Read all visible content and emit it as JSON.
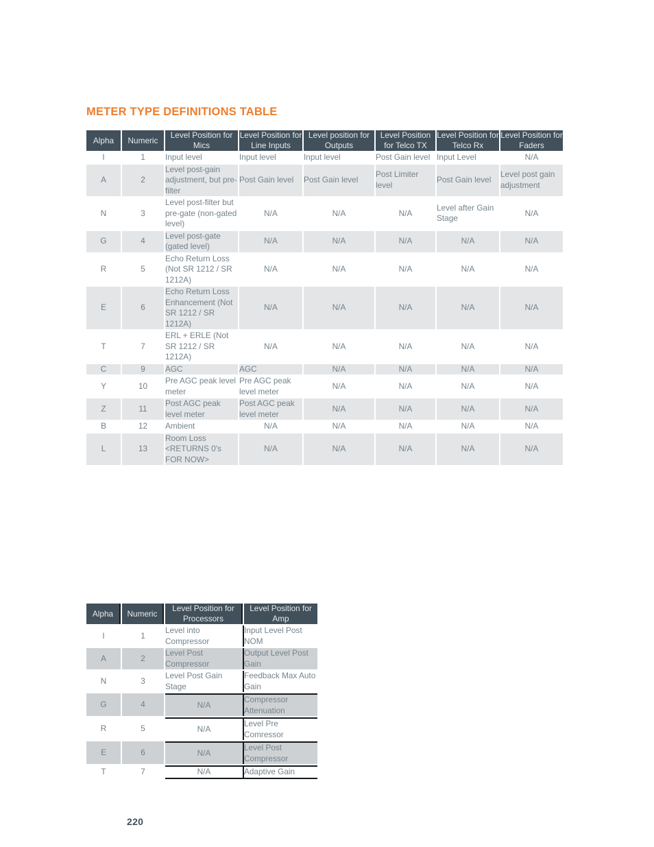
{
  "document": {
    "title": "METER TYPE DEFINITIONS TABLE",
    "page_number": "220",
    "accent_color": "#ee7d2b",
    "header_bg_color": "#41505a",
    "row_shade_table1": "#e3e5e7",
    "row_shade_table2": "#ced1d3",
    "text_color": "#74838c"
  },
  "table1": {
    "headers": [
      "Alpha",
      "Numeric",
      "Level Position for Mics",
      "Level Position for Line Inputs",
      "Level position for Outputs",
      "Level Position for Telco TX",
      "Level Position for Telco Rx",
      "Level Position for Faders"
    ],
    "rows": [
      {
        "alpha": "I",
        "numeric": "1",
        "mics": "Input level",
        "line_inputs": "Input level",
        "outputs": "Input level",
        "telco_tx": "Post Gain level",
        "telco_rx": "Input Level",
        "faders": "N/A"
      },
      {
        "alpha": "A",
        "numeric": "2",
        "mics": "Level post-gain adjustment, but pre-filter",
        "line_inputs": "Post Gain level",
        "outputs": "Post Gain level",
        "telco_tx": "Post Limiter level",
        "telco_rx": "Post Gain level",
        "faders": "Level post gain adjustment"
      },
      {
        "alpha": "N",
        "numeric": "3",
        "mics": "Level post-filter but pre-gate (non-gated level)",
        "line_inputs": "N/A",
        "outputs": "N/A",
        "telco_tx": "N/A",
        "telco_rx": "Level after Gain Stage",
        "faders": "N/A"
      },
      {
        "alpha": "G",
        "numeric": "4",
        "mics": "Level post-gate (gated level)",
        "line_inputs": "N/A",
        "outputs": "N/A",
        "telco_tx": "N/A",
        "telco_rx": "N/A",
        "faders": "N/A"
      },
      {
        "alpha": "R",
        "numeric": "5",
        "mics": "Echo Return Loss (Not  SR 1212 / SR 1212A)",
        "line_inputs": "N/A",
        "outputs": "N/A",
        "telco_tx": "N/A",
        "telco_rx": "N/A",
        "faders": "N/A"
      },
      {
        "alpha": "E",
        "numeric": "6",
        "mics": "Echo Return Loss Enhancement (Not  SR 1212 / SR 1212A)",
        "line_inputs": "N/A",
        "outputs": "N/A",
        "telco_tx": "N/A",
        "telco_rx": "N/A",
        "faders": "N/A"
      },
      {
        "alpha": "T",
        "numeric": "7",
        "mics": "ERL + ERLE (Not  SR 1212 / SR 1212A)",
        "line_inputs": "N/A",
        "outputs": "N/A",
        "telco_tx": "N/A",
        "telco_rx": "N/A",
        "faders": "N/A"
      },
      {
        "alpha": "C",
        "numeric": "9",
        "mics": "AGC",
        "line_inputs": "AGC",
        "outputs": "N/A",
        "telco_tx": "N/A",
        "telco_rx": "N/A",
        "faders": "N/A"
      },
      {
        "alpha": "Y",
        "numeric": "10",
        "mics": "Pre AGC peak level meter",
        "line_inputs": "Pre AGC peak level meter",
        "outputs": "N/A",
        "telco_tx": "N/A",
        "telco_rx": "N/A",
        "faders": "N/A"
      },
      {
        "alpha": "Z",
        "numeric": "11",
        "mics": "Post AGC peak level meter",
        "line_inputs": "Post AGC peak level meter",
        "outputs": "N/A",
        "telco_tx": "N/A",
        "telco_rx": "N/A",
        "faders": "N/A"
      },
      {
        "alpha": "B",
        "numeric": "12",
        "mics": "Ambient",
        "line_inputs": "N/A",
        "outputs": "N/A",
        "telco_tx": "N/A",
        "telco_rx": "N/A",
        "faders": "N/A"
      },
      {
        "alpha": "L",
        "numeric": "13",
        "mics": "Room Loss <RETURNS 0's FOR NOW>",
        "line_inputs": "N/A",
        "outputs": "N/A",
        "telco_tx": "N/A",
        "telco_rx": "N/A",
        "faders": "N/A"
      }
    ]
  },
  "table2": {
    "headers": [
      "Alpha",
      "Numeric",
      "Level Position for Processors",
      "Level Position for Amp"
    ],
    "rows": [
      {
        "alpha": "I",
        "numeric": "1",
        "processors": "Level into Compressor",
        "amp": "Input Level Post NOM"
      },
      {
        "alpha": "A",
        "numeric": "2",
        "processors": "Level Post Compressor",
        "amp": "Output Level Post Gain"
      },
      {
        "alpha": "N",
        "numeric": "3",
        "processors": "Level Post Gain Stage",
        "amp": "Feedback Max Auto Gain"
      },
      {
        "alpha": "G",
        "numeric": "4",
        "processors": "N/A",
        "amp": "Compressor Attenuation"
      },
      {
        "alpha": "R",
        "numeric": "5",
        "processors": "N/A",
        "amp": "Level Pre Comressor"
      },
      {
        "alpha": "E",
        "numeric": "6",
        "processors": "N/A",
        "amp": "Level Post Compressor"
      },
      {
        "alpha": "T",
        "numeric": "7",
        "processors": "N/A",
        "amp": "Adaptive Gain"
      }
    ]
  }
}
